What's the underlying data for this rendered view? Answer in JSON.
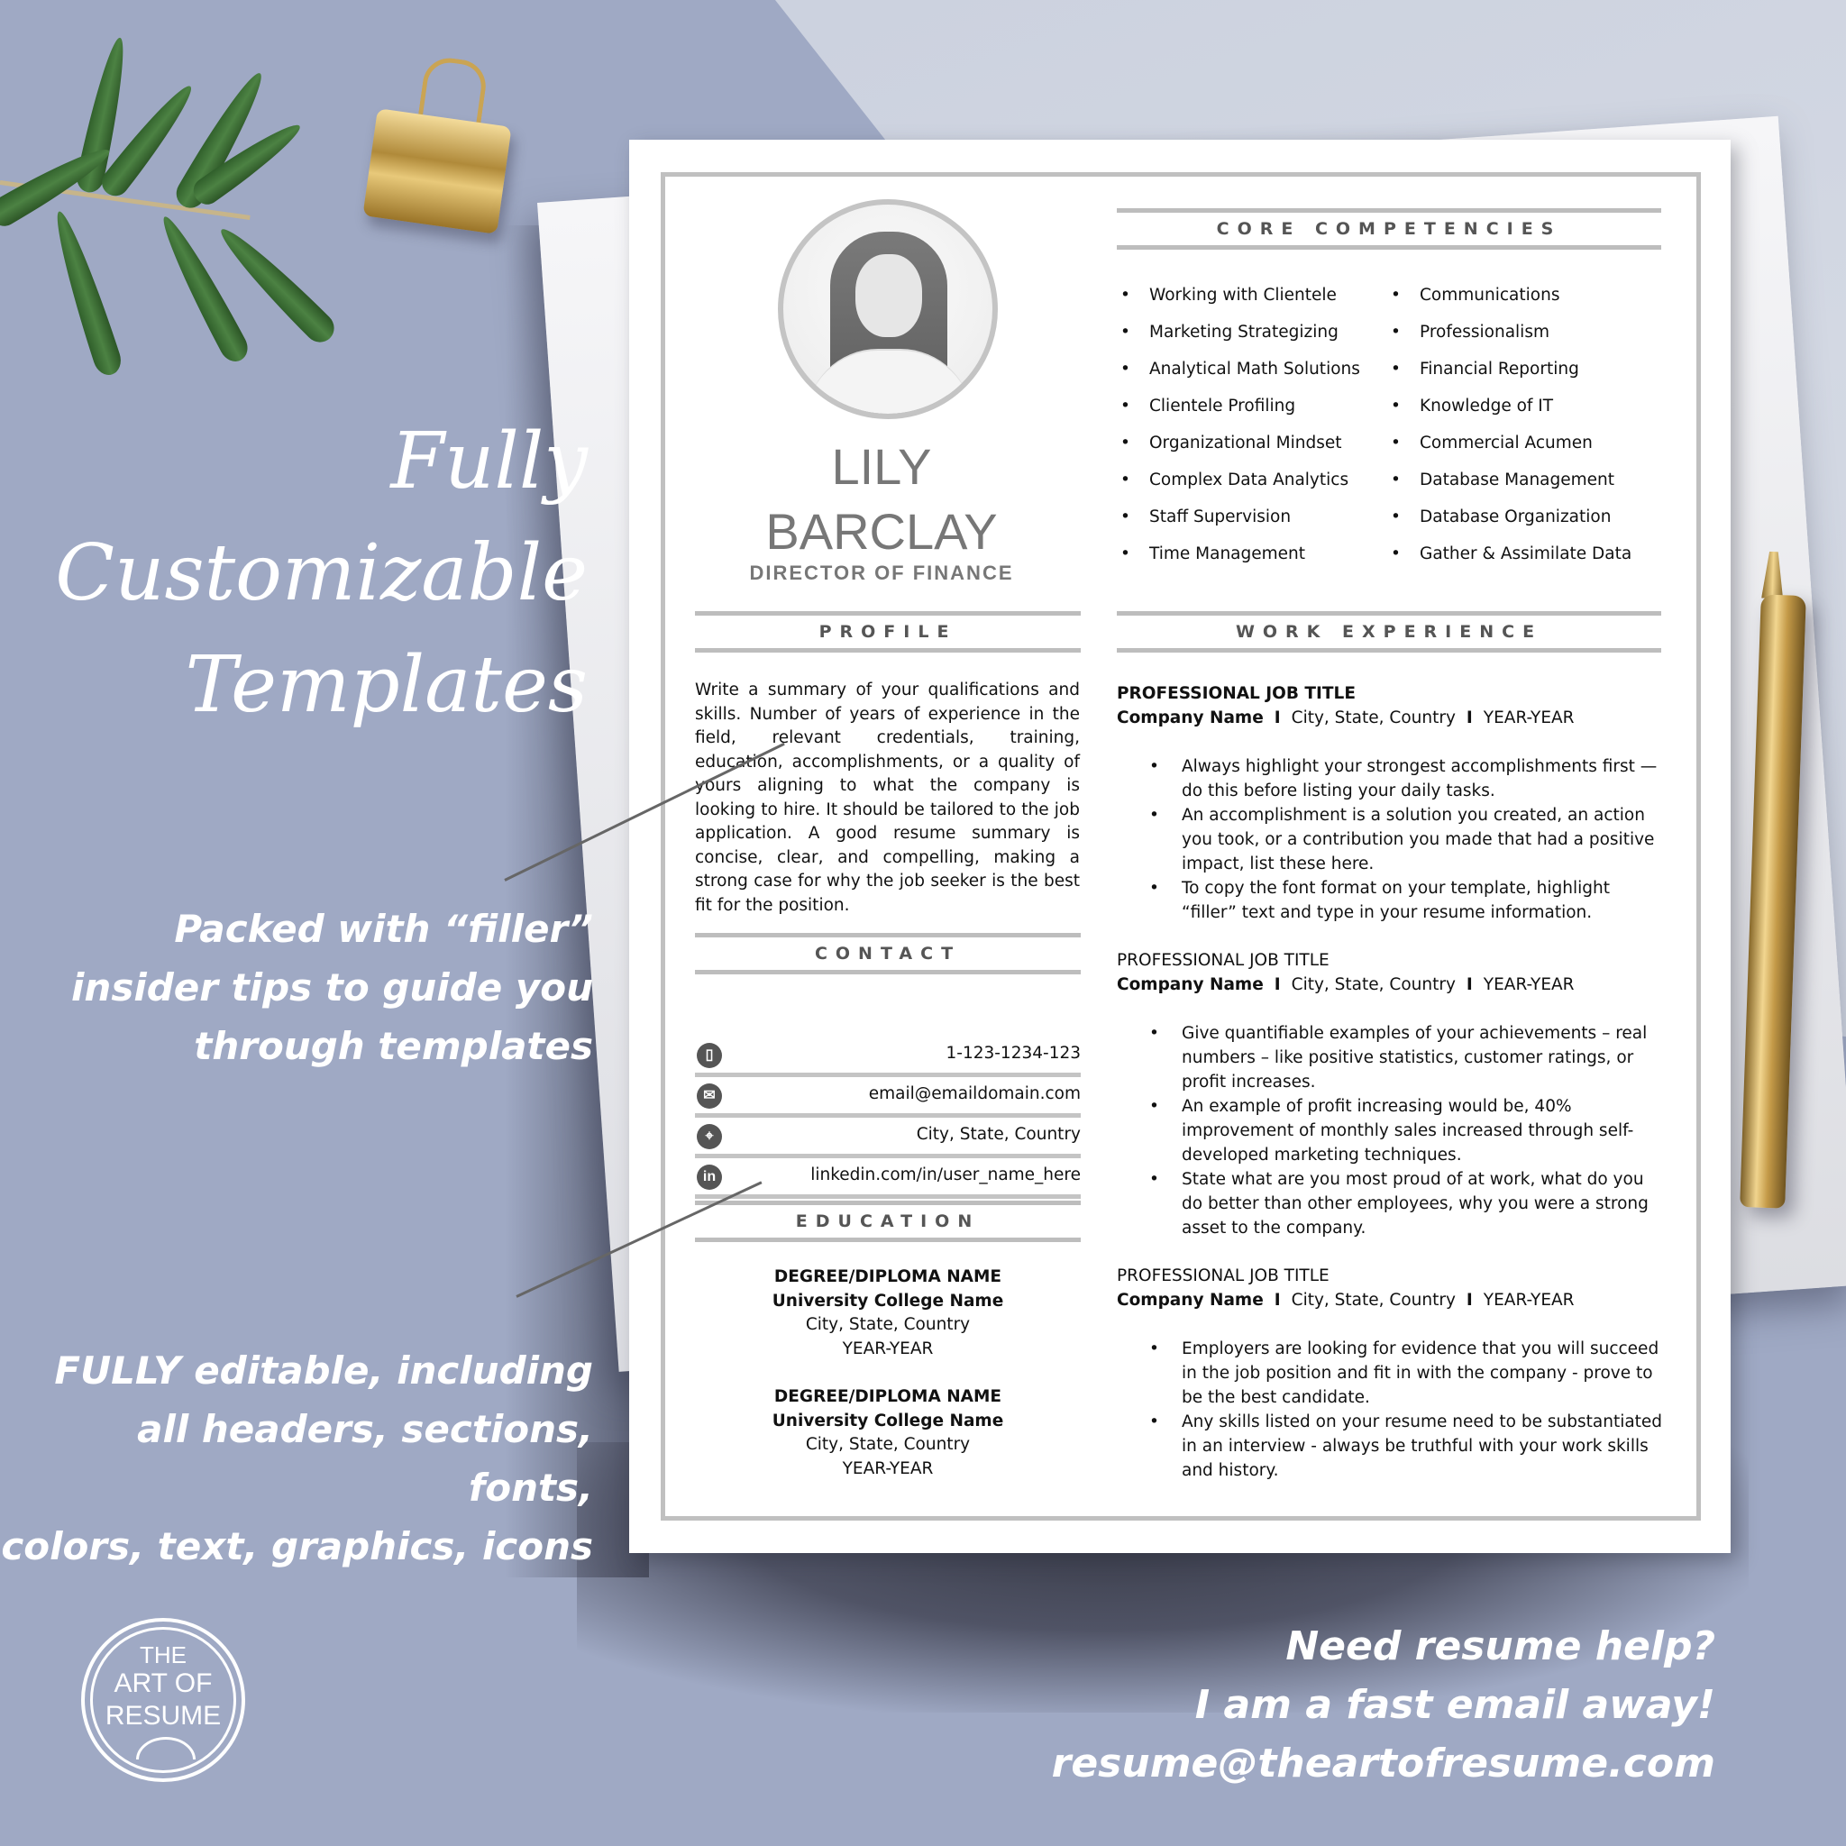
{
  "promo": {
    "headline_lines": [
      "Fully",
      "Customizable",
      "Templates"
    ],
    "filler_lines": [
      "Packed with “filler”",
      "insider tips to guide you",
      "through templates"
    ],
    "editable_lines": [
      "FULLY editable, including",
      "all headers, sections, fonts,",
      "colors, text, graphics, icons"
    ],
    "help_lines": [
      "Need resume help?",
      "I am a fast email away!",
      "resume@theartofresume.com"
    ],
    "logo_lines": [
      "THE",
      "ART OF",
      "RESUME"
    ]
  },
  "resume": {
    "first_name": "LILY",
    "last_name": "BARCLAY",
    "job_title": "DIRECTOR OF FINANCE",
    "sections": {
      "competencies": "CORE COMPETENCIES",
      "profile": "PROFILE",
      "contact": "CONTACT",
      "education": "EDUCATION",
      "work": "WORK EXPERIENCE"
    },
    "profile_text": "Write a summary of your qualifications and skills. Number of years of experience in the field, relevant credentials, training, education, accomplishments, or a quality of yours aligning to what the company is looking to hire. It should be tailored to the job application. A good resume summary is concise, clear, and compelling, making a strong case for why the job seeker is the best fit for the position.",
    "contact": [
      {
        "icon": "phone-icon",
        "glyph": "▯",
        "value": "1-123-1234-123"
      },
      {
        "icon": "email-icon",
        "glyph": "✉",
        "value": "email@emaildomain.com"
      },
      {
        "icon": "location-pin-icon",
        "glyph": "⌖",
        "value": "City, State, Country"
      },
      {
        "icon": "linkedin-icon",
        "glyph": "in",
        "value": "linkedin.com/in/user_name_here"
      }
    ],
    "education": [
      {
        "degree": "DEGREE/DIPLOMA NAME",
        "school": "University College Name",
        "location": "City, State, Country",
        "years": "YEAR-YEAR"
      },
      {
        "degree": "DEGREE/DIPLOMA NAME",
        "school": "University College Name",
        "location": "City, State, Country",
        "years": "YEAR-YEAR"
      }
    ],
    "competencies_left": [
      "Working with Clientele",
      "Marketing Strategizing",
      "Analytical Math Solutions",
      "Clientele Profiling",
      "Organizational Mindset",
      "Complex Data Analytics",
      "Staff Supervision",
      "Time Management"
    ],
    "competencies_right": [
      "Communications",
      "Professionalism",
      "Financial Reporting",
      "Knowledge of IT",
      "Commercial Acumen",
      "Database Management",
      "Database Organization",
      "Gather & Assimilate Data"
    ],
    "jobs": [
      {
        "title": "PROFESSIONAL JOB TITLE",
        "company": "Company Name",
        "separator": "I",
        "location": "City, State, Country",
        "years": "YEAR-YEAR",
        "bullets": [
          "Always highlight your strongest accomplishments first —do this before listing your daily tasks.",
          "An accomplishment is a solution you created, an action you took, or a contribution you made that had a positive impact, list these here.",
          "To copy the font format on your template, highlight “filler” text and type in your resume information."
        ]
      },
      {
        "title": "PROFESSIONAL JOB TITLE",
        "company": "Company Name",
        "separator": "I",
        "location": "City, State, Country",
        "years": "YEAR-YEAR",
        "bullets": [
          "Give quantifiable examples of your achievements – real numbers – like positive statistics, customer ratings, or profit increases.",
          "An example of profit increasing would be, 40% improvement of monthly sales increased through self-developed marketing techniques.",
          "State what are you most proud of at work, what do you do better than other employees, why you were a strong asset to the company."
        ]
      },
      {
        "title": "PROFESSIONAL JOB TITLE",
        "company": "Company Name",
        "separator": "I",
        "location": "City, State, Country",
        "years": "YEAR-YEAR",
        "bullets": [
          "Employers are looking for evidence that you will succeed in the job position and fit in with the company - prove to be the best candidate.",
          "Any skills listed on your resume need to be substantiated in an interview - always be truthful with your work skills and history."
        ]
      }
    ]
  },
  "colors": {
    "background": "#9fa9c4",
    "section_rule": "#bdbdbd",
    "heading_text": "#555555",
    "name_text": "#777777",
    "body_text": "#111111"
  }
}
